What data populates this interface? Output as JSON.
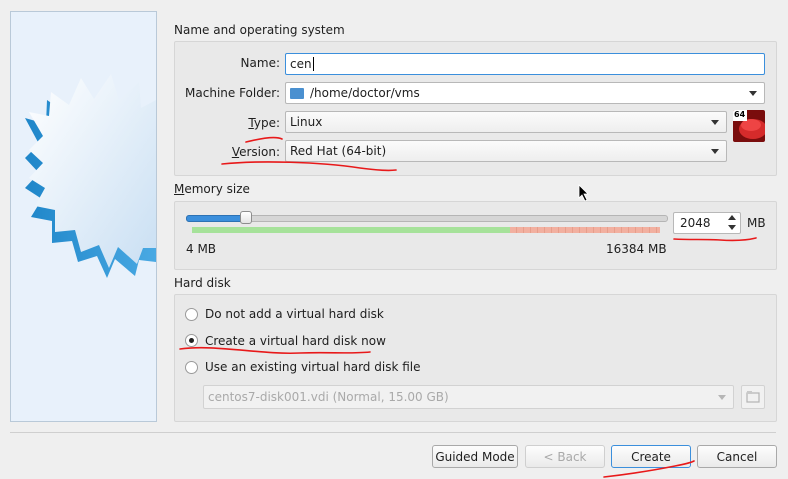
{
  "sections": {
    "name_os": "Name and operating system",
    "memory": "Memory size",
    "hard_disk": "Hard disk"
  },
  "name": {
    "label": "Name:",
    "value": "cen"
  },
  "machine_folder": {
    "label": "Machine Folder:",
    "value": "/home/doctor/vms"
  },
  "type": {
    "label": "Type:",
    "value": "Linux"
  },
  "version": {
    "label": "Version:",
    "value": "Red Hat (64-bit)"
  },
  "os_badge": "64",
  "memory": {
    "min_label": "4 MB",
    "max_label": "16384 MB",
    "value": "2048",
    "unit": "MB",
    "slider_fraction": 0.125
  },
  "hard_disk": {
    "option_none": "Do not add a virtual hard disk",
    "option_create": "Create a virtual hard disk now",
    "option_existing": "Use an existing virtual hard disk file",
    "selected": "create",
    "existing_file": "centos7-disk001.vdi (Normal, 15.00 GB)"
  },
  "buttons": {
    "guided": "Guided Mode",
    "back": "< Back",
    "create": "Create",
    "cancel": "Cancel"
  },
  "colors": {
    "accent": "#3b8fdc",
    "slider_safe": "#a6e29a",
    "slider_warn": "#f2b0a0",
    "annotation": "#e8191a"
  }
}
